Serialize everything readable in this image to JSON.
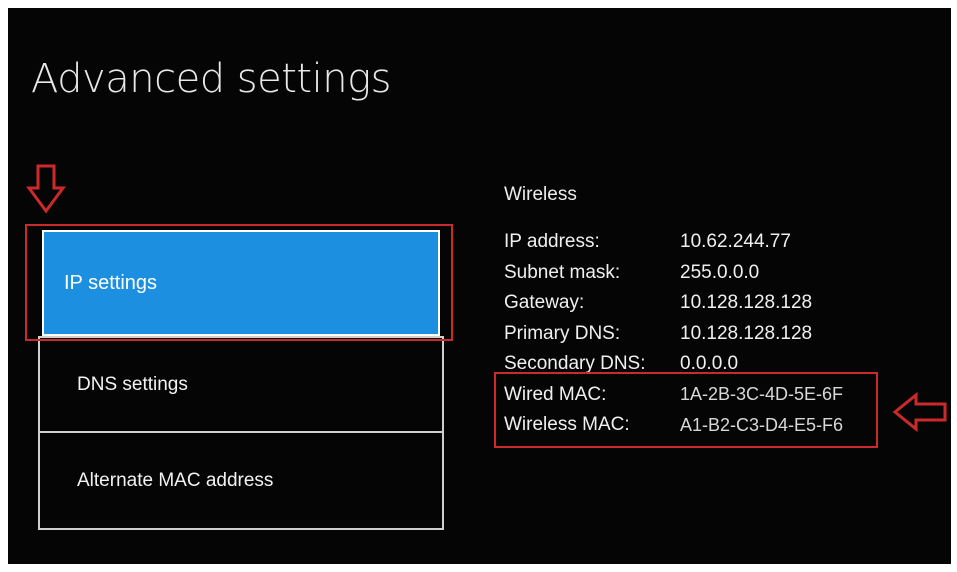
{
  "page": {
    "title": "Advanced settings"
  },
  "menu": {
    "items": [
      {
        "label": "IP settings",
        "selected": true
      },
      {
        "label": "DNS settings",
        "selected": false
      },
      {
        "label": "Alternate MAC address",
        "selected": false
      }
    ]
  },
  "network": {
    "heading": "Wireless",
    "ip_address": {
      "label": "IP address:",
      "value": "10.62.244.77"
    },
    "subnet_mask": {
      "label": "Subnet mask:",
      "value": "255.0.0.0"
    },
    "gateway": {
      "label": "Gateway:",
      "value": "10.128.128.128"
    },
    "primary_dns": {
      "label": "Primary DNS:",
      "value": "10.128.128.128"
    },
    "secondary_dns": {
      "label": "Secondary DNS:",
      "value": "0.0.0.0"
    },
    "wired_mac": {
      "label": "Wired MAC:",
      "value": "1A-2B-3C-4D-5E-6F"
    },
    "wireless_mac": {
      "label": "Wireless MAC:",
      "value": "A1-B2-C3-D4-E5-F6"
    }
  },
  "colors": {
    "selected_tile": "#1d8fe0",
    "annotation_red": "#cc2a2a",
    "background": "#050505"
  },
  "icons": [
    "down-arrow-annotation-icon",
    "left-arrow-annotation-icon"
  ]
}
